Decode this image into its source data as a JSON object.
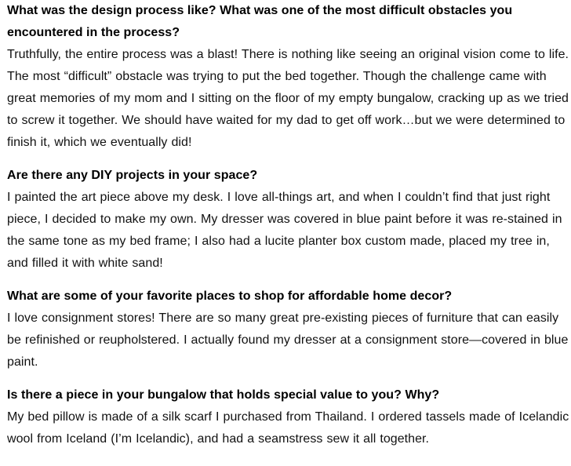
{
  "qa": [
    {
      "question": "What was the design process like? What was one of the most difficult obstacles you encountered in the process?",
      "answer": "Truthfully, the entire process was a blast! There is nothing like seeing an original vision come to life. The most “difficult” obstacle was trying to put the bed together. Though the challenge came with great memories of my mom and I sitting on the floor of my empty bungalow, cracking up as we tried to screw it together. We should have waited for my dad to get off work…but we were determined to finish it, which we eventually did!"
    },
    {
      "question": "Are there any DIY projects in your space?",
      "answer": "I painted the art piece above my desk. I love all-things art, and when I couldn’t find that just right piece, I decided to make my own. My dresser was covered in blue paint before it was re-stained in the same tone as my bed frame; I also had a lucite planter box custom made, placed my tree in, and filled it with white sand!"
    },
    {
      "question": "What are some of your favorite places to shop for affordable home decor?",
      "answer": "I love consignment stores! There are so many great pre-existing pieces of furniture that can easily be refinished or reupholstered. I actually found my dresser at a consignment store—covered in blue paint."
    },
    {
      "question": "Is there a piece in your bungalow that holds special value to you? Why?",
      "answer": "My bed pillow is made of a silk scarf I purchased from Thailand. I ordered tassels made of Icelandic wool from Iceland (I’m Icelandic), and had a seamstress sew it all together."
    }
  ]
}
